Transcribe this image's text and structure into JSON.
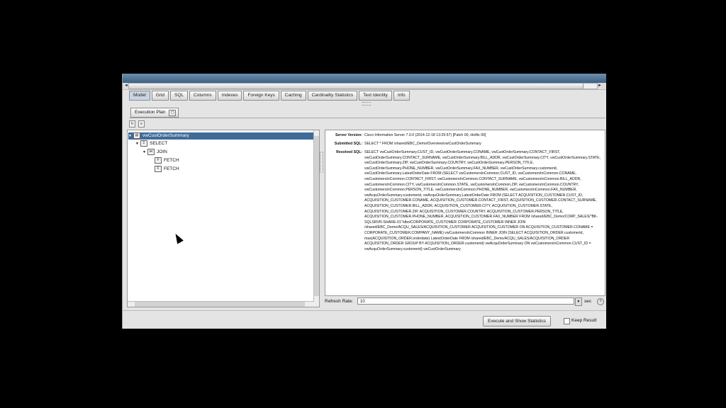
{
  "top_tabs": [
    "Model",
    "Grid",
    "SQL",
    "Columns",
    "Indexes",
    "Foreign Keys",
    "Caching",
    "Cardinality Statistics",
    "Text Identity",
    "Info"
  ],
  "sub_tab": {
    "label": "Execution Plan"
  },
  "tree": {
    "root": "vwCustOrderSummary",
    "select": "SELECT",
    "join": "JOIN",
    "fetch1": "FETCH",
    "fetch2": "FETCH"
  },
  "details": {
    "server_version_label": "Server Version:",
    "server_version_value": "Cisco Information Server 7.0.0 (2014-12-18 13:29:57) [Patch 00, Hotfix 00]",
    "submitted_sql_label": "Submitted SQL:",
    "submitted_sql_value": "SELECT * FROM /shared/EBC_Demo/Overview/vwCustOrderSummary",
    "resolved_sql_label": "Resolved SQL:",
    "resolved_sql_value": "SELECT vwCustOrderSummary.CUST_ID, vwCustOrderSummary.CONAME, vwCustOrderSummary.CONTACT_FIRST, vwCustOrderSummary.CONTACT_SURNAME, vwCustOrderSummary.BILL_ADDR, vwCustOrderSummary.CITY, vwCustOrderSummary.STATE, vwCustOrderSummary.ZIP, vwCustOrderSummary.COUNTRY, vwCustOrderSummary.PERSON_TITLE, vwCustOrderSummary.PHONE_NUMBER, vwCustOrderSummary.FAX_NUMBER, vwCustOrderSummary.customerid, vwCustOrderSummary.LatestOrderDate FROM (SELECT vwCustomersInCommon.CUST_ID, vwCustomersInCommon.CONAME, vwCustomersInCommon.CONTACT_FIRST, vwCustomersInCommon.CONTACT_SURNAME, vwCustomersInCommon.BILL_ADDR, vwCustomersInCommon.CITY, vwCustomersInCommon.STATE, vwCustomersInCommon.ZIP, vwCustomersInCommon.COUNTRY, vwCustomersInCommon.PERSON_TITLE, vwCustomersInCommon.PHONE_NUMBER, vwCustomersInCommon.FAX_NUMBER, vwAcquOrderSummary.customerid, vwAcquOrderSummary.LatestOrderDate FROM (SELECT ACQUISITION_CUSTOMER.CUST_ID, ACQUISITION_CUSTOMER.CONAME, ACQUISITION_CUSTOMER.CONTACT_FIRST, ACQUISITION_CUSTOMER.CONTACT_SURNAME, ACQUISITION_CUSTOMER.BILL_ADDR, ACQUISITION_CUSTOMER.CITY, ACQUISITION_CUSTOMER.STATE, ACQUISITION_CUSTOMER.ZIP, ACQUISITION_CUSTOMER.COUNTRY, ACQUISITION_CUSTOMER.PERSON_TITLE, ACQUISITION_CUSTOMER.PHONE_NUMBER, ACQUISITION_CUSTOMER.FAX_NUMBER FROM /shared/EBC_Demo/CORP_SALES/\"BK-SQLSRVR-SHARE-01\"/dbo/CORPORATE_CUSTOMER CORPORATE_CUSTOMER INNER JOIN /shared/EBC_Demo/ACQU_SALES/ACQUISITION_CUSTOMER ACQUISITION_CUSTOMER ON ACQUISITION_CUSTOMER.CONAME = CORPORATE_CUSTOMER.COMPANY_NAME) vwCustomersInCommon INNER JOIN (SELECT ACQUISITION_ORDER.customerid, max(ACQUISITION_ORDER.orderdate) LatestOrderDate FROM /shared/EBC_Demo/ACQU_SALES/ACQUISITION_ORDER ACQUISITION_ORDER GROUP BY ACQUISITION_ORDER.customerid) vwAcquOrderSummary ON vwCustomersInCommon.CUST_ID = vwAcquOrderSummary.customerid) vwCustOrderSummary"
  },
  "refresh": {
    "label": "Refresh Rate:",
    "value": "10",
    "unit": "sec"
  },
  "footer": {
    "execute_label": "Execute and Show Statistics",
    "keep_result_label": "Keep Result"
  }
}
